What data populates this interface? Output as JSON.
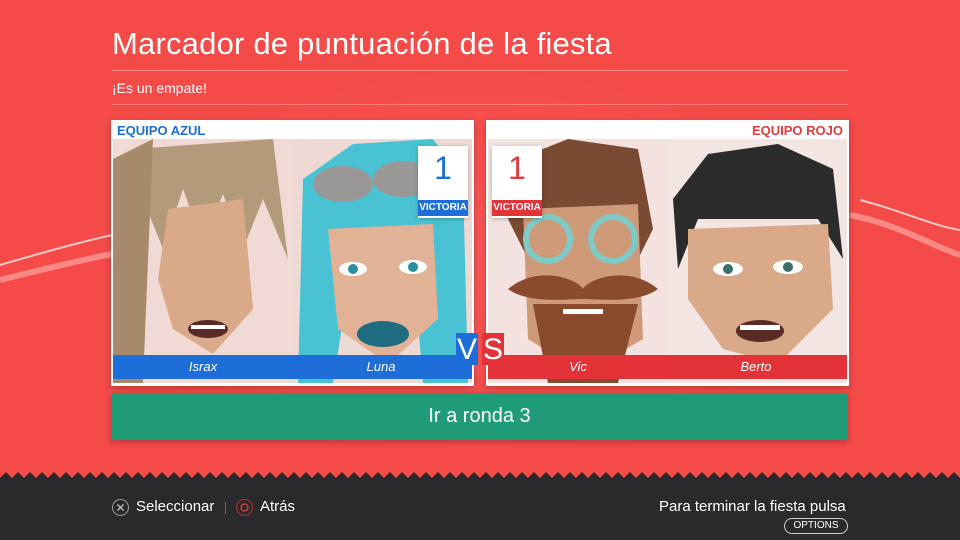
{
  "header": {
    "title": "Marcador de puntuación de la fiesta",
    "subtitle": "¡Es un empate!"
  },
  "teams": {
    "blue": {
      "label": "EQUIPO AZUL",
      "score": "1",
      "result_tag": "VICTORIA",
      "players": [
        "Israx",
        "Luna"
      ],
      "color": "#1d6ed8"
    },
    "red": {
      "label": "EQUIPO ROJO",
      "score": "1",
      "result_tag": "VICTORIA",
      "players": [
        "Vic",
        "Berto"
      ],
      "color": "#e33339"
    }
  },
  "versus": {
    "v": "V",
    "s": "S"
  },
  "action": {
    "next_round_label": "Ir a ronda 3"
  },
  "footer": {
    "select_label": "Seleccionar",
    "back_label": "Atrás",
    "end_party_text": "Para terminar la fiesta pulsa",
    "options_label": "OPTIONS"
  },
  "colors": {
    "background": "#f44a48",
    "confirm_button": "#1f9b78",
    "footer": "#2a2a2c"
  }
}
